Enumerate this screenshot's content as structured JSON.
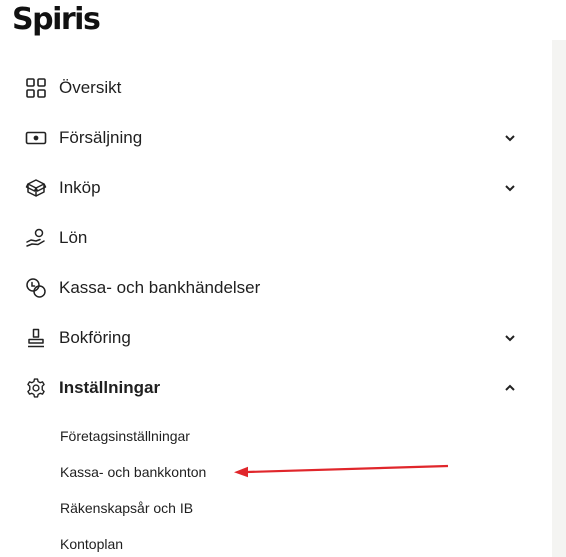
{
  "brand": {
    "name": "Spiris"
  },
  "nav": {
    "items": [
      {
        "label": "Översikt",
        "icon": "grid-icon",
        "expandable": false
      },
      {
        "label": "Försäljning",
        "icon": "cash-icon",
        "expandable": true,
        "expanded": false
      },
      {
        "label": "Inköp",
        "icon": "box-icon",
        "expandable": true,
        "expanded": false
      },
      {
        "label": "Lön",
        "icon": "hand-coin-icon",
        "expandable": false
      },
      {
        "label": "Kassa- och bankhändelser",
        "icon": "coins-icon",
        "expandable": false
      },
      {
        "label": "Bokföring",
        "icon": "stamp-icon",
        "expandable": true,
        "expanded": false
      },
      {
        "label": "Inställningar",
        "icon": "gear-icon",
        "expandable": true,
        "expanded": true,
        "active": true
      }
    ],
    "settings_submenu": [
      "Företagsinställningar",
      "Kassa- och bankkonton",
      "Räkenskapsår och IB",
      "Kontoplan"
    ]
  },
  "annotation": {
    "arrow_color": "#e0262b",
    "points_to": "Kassa- och bankkonton"
  },
  "colors": {
    "text": "#1f1f1f",
    "rail": "#f4f4f2",
    "arrow": "#e0262b"
  }
}
